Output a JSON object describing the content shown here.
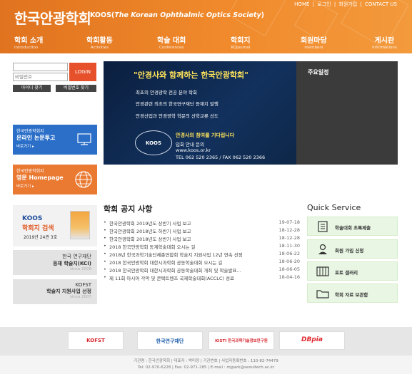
{
  "header": {
    "logo_kor": "한국안광학회",
    "logo_eng_prefix": "KOOS(",
    "logo_eng_italic": "The Korean Ophthalmic Optics Society",
    "logo_eng_suffix": ")",
    "top_links": [
      "HOME",
      "로그인",
      "회원가입",
      "CONTACT US"
    ],
    "top_sep": "|",
    "brand_color": "#f08a2c"
  },
  "nav": [
    {
      "ko": "학회 소개",
      "en": "Introduction"
    },
    {
      "ko": "학회활동",
      "en": "Activities"
    },
    {
      "ko": "학술 대회",
      "en": "Conferences"
    },
    {
      "ko": "학회지",
      "en": "KOJournal"
    },
    {
      "ko": "회원마당",
      "en": "members"
    },
    {
      "ko": "게시판",
      "en": "Informations"
    }
  ],
  "login": {
    "id_placeholder": "",
    "pw_placeholder": "비밀번호",
    "login_label": "LOGIN",
    "find_id": "아이디 찾기",
    "find_pw": "비밀번호 찾기"
  },
  "banners": {
    "online": {
      "small": "한국안광학회지",
      "big": "온라인 논문투고",
      "go": "바로가기 ▸",
      "icon": "monitor-icon"
    },
    "english": {
      "small": "한국안광학회지",
      "big": "영문 Homepage",
      "go": "바로가기 ▸",
      "icon": "globe-icon"
    }
  },
  "hero": {
    "title": "\"안경사와 함께하는 한국안광학회\"",
    "lines": [
      "최초의 안경광학 전공 분야 학회",
      "안경관련 최초의 한국연구재단 등재지 발행",
      "안경산업과 안경광학 학문의 산학교류 선도"
    ],
    "cta": "안경사의 참여를 기다립니다",
    "info": [
      "입회 안내 문의",
      "www.koos.or.kr",
      "TEL 062 520 2365 / FAX 062 520 2366"
    ],
    "seal_text": "KOOS"
  },
  "schedule": {
    "title": "주요일정"
  },
  "koos_box": {
    "title1": "KOOS",
    "title2": "학회지 검색",
    "issue": "2019년 24권 3호"
  },
  "gray_boxes": [
    {
      "line1": "한국 연구재단",
      "line2": "등재 학술지(KCI)",
      "line3": "since 2009"
    },
    {
      "line1": "KOFST",
      "line2": "학술지 지원사업 선정",
      "line3": "since 2007"
    }
  ],
  "notices": {
    "title": "학회 공지 사항",
    "bullet": "•",
    "items": [
      {
        "text": "한국안광학회 2019년도 상반기 사업 보고",
        "date": "19-07-18"
      },
      {
        "text": "한국안광학회 2018년도 하반기 사업 보고",
        "date": "18-12-28"
      },
      {
        "text": "한국안광학회 2018년도 상반기 사업 보고",
        "date": "18-12-28"
      },
      {
        "text": "2018 한국안광학회 동계학술대회 오시는 길",
        "date": "18-11-30"
      },
      {
        "text": "2018년 한국과학기술단체총연합회 학술지 지원사업 12년 연속 선정",
        "date": "18-06-22"
      },
      {
        "text": "2018 한국안광학회 대한시과학회 공동학술대회 오시는 길",
        "date": "18-06-20"
      },
      {
        "text": "2018 한국안광학회 대한시과학회 공동학술대회 개최 및 학술발표...",
        "date": "18-06-05"
      },
      {
        "text": "제 11회 아시아 각막 및 콘택트렌즈 국제학술대회(ACCLC) 성료",
        "date": "18-04-16"
      }
    ]
  },
  "quick_service": {
    "title": "Quick Service",
    "items": [
      {
        "label": "학술대회 초록제출",
        "icon": "document-icon",
        "glyph": "▤"
      },
      {
        "label": "회원 가입 신청",
        "icon": "person-icon",
        "glyph": "👤"
      },
      {
        "label": "포토 갤러리",
        "icon": "gallery-icon",
        "glyph": "▦"
      },
      {
        "label": "학회 자료 보관함",
        "icon": "folder-icon",
        "glyph": "▭"
      }
    ]
  },
  "partners": [
    {
      "name": "KOFST",
      "color": "#d7262e"
    },
    {
      "name": "한국연구재단",
      "color": "#1b5cab"
    },
    {
      "name": "KISTI 한국과학기술정보연구원",
      "color": "#d7262e"
    },
    {
      "name": "DBpia",
      "color": "#e0262e"
    }
  ],
  "footer": {
    "line1": "기관명 : 한국안광학회 | 대표자 : 박미정 | 기관번호 | 사업자등록번호 : 110-82-74479",
    "line2": "Tel: 02-970-6228 | Fax: 02-971-285 | E-mail : mjpark@seoultech.ac.kr"
  }
}
